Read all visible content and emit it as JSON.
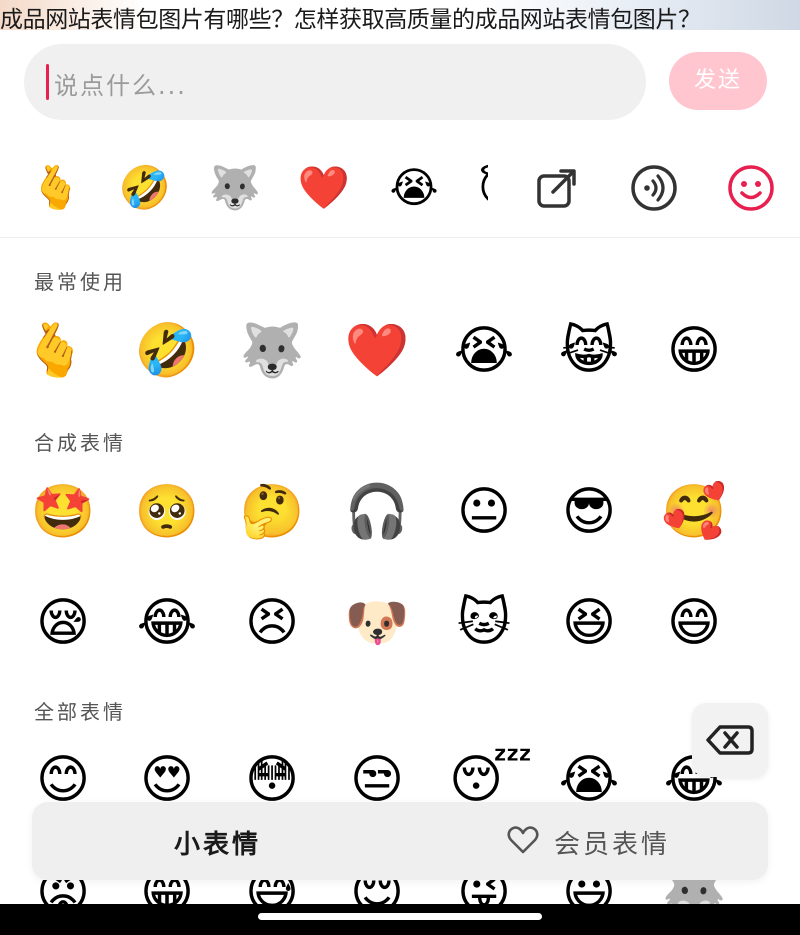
{
  "header": {
    "title": "成品网站表情包图片有哪些？怎样获取高质量的成品网站表情包图片？"
  },
  "input": {
    "placeholder": "说点什么..."
  },
  "send_button": {
    "label": "发送"
  },
  "quick_bar": {
    "emojis": [
      "🫰",
      "🤣",
      "🐺",
      "❤️",
      "😭"
    ],
    "partial_emoji": "😇",
    "icons": [
      "share-icon",
      "voice-icon",
      "emoji-face-icon"
    ]
  },
  "sections": {
    "recent": {
      "title": "最常使用",
      "emojis": [
        "🫰",
        "🤣",
        "🐺",
        "❤️",
        "😭",
        "😹",
        "😁"
      ]
    },
    "combined": {
      "title": "合成表情",
      "row1": [
        "🤩",
        "🥺",
        "🤔",
        "🎧",
        "😐",
        "😎",
        "🥰"
      ],
      "row2": [
        "😪",
        "😂",
        "😣",
        "🐶",
        "🐱",
        "😆",
        "😄"
      ]
    },
    "all": {
      "title": "全部表情",
      "row1": [
        "😊",
        "😍",
        "😳",
        "😒",
        "😴",
        "😭",
        "😂"
      ],
      "row2": [
        "😡",
        "😁",
        "😅",
        "😌",
        "😜",
        "😃",
        "🐺"
      ]
    }
  },
  "tabs": {
    "small": "小表情",
    "member": "会员表情"
  },
  "colors": {
    "accent": "#e8204f",
    "send_button_bg": "#ffc6d0",
    "tab_bar_bg": "#efefef"
  }
}
